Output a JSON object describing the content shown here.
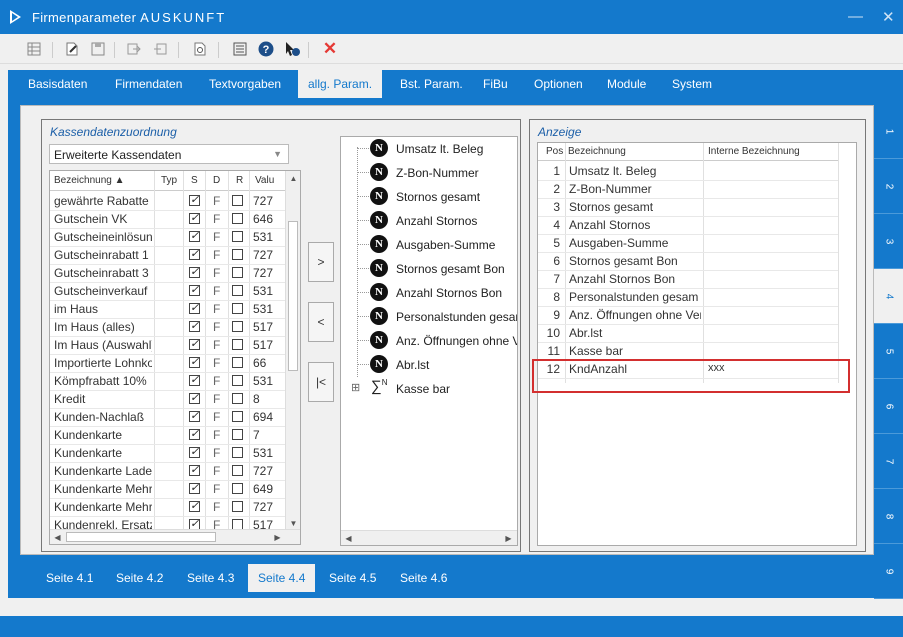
{
  "window": {
    "title_prefix": "Firmenparameter",
    "title_main": "AUSKUNFT",
    "minimize": "—",
    "close": "✕"
  },
  "toolbar": {
    "icons": [
      "table-icon",
      "edit-icon",
      "save-icon",
      "import-icon",
      "export-icon",
      "preview-icon",
      "list-icon",
      "help-icon",
      "pointer-help-icon",
      "cancel-icon"
    ]
  },
  "menu": [
    {
      "label": "Basisdaten"
    },
    {
      "label": "Firmendaten"
    },
    {
      "label": "Textvorgaben"
    },
    {
      "label": "allg. Param."
    },
    {
      "label": "Bst. Param."
    },
    {
      "label": "FiBu"
    },
    {
      "label": "Optionen"
    },
    {
      "label": "Module"
    },
    {
      "label": "System"
    }
  ],
  "left": {
    "caption": "Kassendatenzuordnung",
    "combo_value": "Erweiterte Kassendaten",
    "columns": [
      "Bezeichnung",
      "Typ",
      "S",
      "D",
      "R",
      "Valu"
    ],
    "rows": [
      {
        "name": "gewährte Rabatte",
        "s": true,
        "d": "F",
        "r": false,
        "val": "727"
      },
      {
        "name": "Gutschein VK",
        "s": true,
        "d": "F",
        "r": false,
        "val": "646"
      },
      {
        "name": "Gutscheineinlösun",
        "s": true,
        "d": "F",
        "r": false,
        "val": "531"
      },
      {
        "name": "Gutscheinrabatt 1",
        "s": true,
        "d": "F",
        "r": false,
        "val": "727"
      },
      {
        "name": "Gutscheinrabatt 3",
        "s": true,
        "d": "F",
        "r": false,
        "val": "727"
      },
      {
        "name": "Gutscheinverkauf",
        "s": true,
        "d": "F",
        "r": false,
        "val": "531"
      },
      {
        "name": "im Haus",
        "s": true,
        "d": "F",
        "r": false,
        "val": "531"
      },
      {
        "name": "Im Haus (alles)",
        "s": true,
        "d": "F",
        "r": false,
        "val": "517"
      },
      {
        "name": "Im Haus (Auswahl)",
        "s": true,
        "d": "F",
        "r": false,
        "val": "517"
      },
      {
        "name": "Importierte Lohnko",
        "s": true,
        "d": "F",
        "r": false,
        "val": "66"
      },
      {
        "name": "Kömpfrabatt 10%",
        "s": true,
        "d": "F",
        "r": false,
        "val": "531"
      },
      {
        "name": "Kredit",
        "s": true,
        "d": "F",
        "r": false,
        "val": "8"
      },
      {
        "name": "Kunden-Nachlaß",
        "s": true,
        "d": "F",
        "r": false,
        "val": "694"
      },
      {
        "name": "Kundenkarte",
        "s": true,
        "d": "F",
        "r": false,
        "val": "7"
      },
      {
        "name": "Kundenkarte",
        "s": true,
        "d": "F",
        "r": false,
        "val": "531"
      },
      {
        "name": "Kundenkarte Lade",
        "s": true,
        "d": "F",
        "r": false,
        "val": "727"
      },
      {
        "name": "Kundenkarte Mehr:",
        "s": true,
        "d": "F",
        "r": false,
        "val": "649"
      },
      {
        "name": "Kundenkarte Mehrl",
        "s": true,
        "d": "F",
        "r": false,
        "val": "727"
      },
      {
        "name": "Kundenrekl. Ersatz",
        "s": true,
        "d": "F",
        "r": false,
        "val": "517"
      }
    ]
  },
  "buttons": {
    "add": ">",
    "remove": "<",
    "remove_all": "|<"
  },
  "tree": {
    "items": [
      "Umsatz lt. Beleg",
      "Z-Bon-Nummer",
      "Stornos gesamt",
      "Anzahl Stornos",
      "Ausgaben-Summe",
      "Stornos gesamt Bon",
      "Anzahl Stornos Bon",
      "Personalstunden gesam",
      "Anz. Öffnungen ohne Ver",
      "Abr.lst"
    ],
    "node_glyph": "N",
    "group_label": "Kasse bar",
    "group_sigma": "∑",
    "group_sigma_sup": "N",
    "expander": "⊞"
  },
  "right": {
    "caption": "Anzeige",
    "columns": [
      "Pos",
      "Bezeichnung",
      "Interne Bezeichnung"
    ],
    "rows": [
      {
        "pos": "1",
        "name": "Umsatz lt. Beleg",
        "intern": ""
      },
      {
        "pos": "2",
        "name": "Z-Bon-Nummer",
        "intern": ""
      },
      {
        "pos": "3",
        "name": "Stornos gesamt",
        "intern": ""
      },
      {
        "pos": "4",
        "name": "Anzahl Stornos",
        "intern": ""
      },
      {
        "pos": "5",
        "name": "Ausgaben-Summe",
        "intern": ""
      },
      {
        "pos": "6",
        "name": "Stornos gesamt Bon",
        "intern": ""
      },
      {
        "pos": "7",
        "name": "Anzahl Stornos Bon",
        "intern": ""
      },
      {
        "pos": "8",
        "name": "Personalstunden gesam",
        "intern": ""
      },
      {
        "pos": "9",
        "name": "Anz. Öffnungen ohne Ver",
        "intern": ""
      },
      {
        "pos": "10",
        "name": "Abr.lst",
        "intern": ""
      },
      {
        "pos": "11",
        "name": "Kasse bar",
        "intern": ""
      },
      {
        "pos": "12",
        "name": "KndAnzahl",
        "intern": "xxx"
      }
    ]
  },
  "side_tabs": [
    "1",
    "2",
    "3",
    "4",
    "5",
    "6",
    "7",
    "8",
    "9"
  ],
  "active_side_tab": "4",
  "page_tabs": [
    "Seite 4.1",
    "Seite 4.2",
    "Seite 4.3",
    "Seite 4.4",
    "Seite 4.5",
    "Seite 4.6"
  ],
  "active_page_tab": "Seite 4.4",
  "colors": {
    "accent": "#1479cc",
    "highlight": "#d32f2f",
    "caption": "#1c5fa8"
  }
}
